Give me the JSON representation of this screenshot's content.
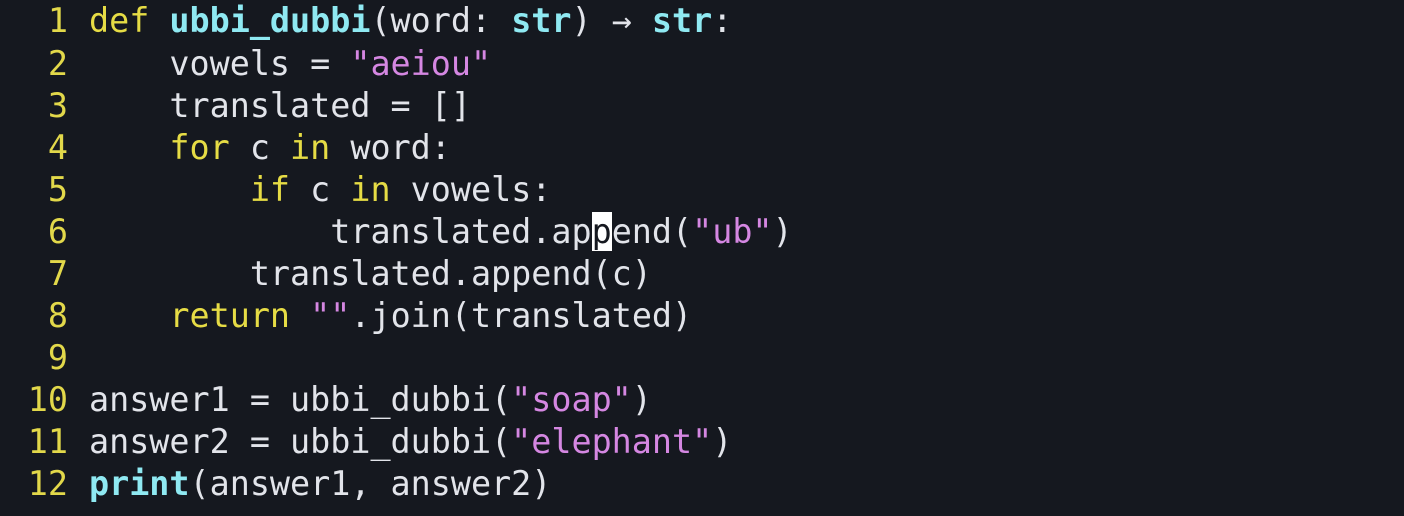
{
  "editor": {
    "language": "python",
    "cursor": {
      "line": 6,
      "column": 31
    },
    "colors": {
      "background": "#15181f",
      "line_number": "#e2d84a",
      "keyword": "#e6dc45",
      "function_and_type": "#8fe9f2",
      "string": "#d587e2",
      "default_text": "#e2e4ea",
      "cursor": "#ffffff"
    },
    "lines": [
      {
        "number": "1",
        "tokens": [
          {
            "text": "def",
            "kind": "kw"
          },
          {
            "text": " ",
            "kind": "tx"
          },
          {
            "text": "ubbi_dubbi",
            "kind": "fn"
          },
          {
            "text": "(word: ",
            "kind": "tx"
          },
          {
            "text": "str",
            "kind": "ty"
          },
          {
            "text": ") → ",
            "kind": "tx"
          },
          {
            "text": "str",
            "kind": "ty"
          },
          {
            "text": ":",
            "kind": "tx"
          }
        ]
      },
      {
        "number": "2",
        "tokens": [
          {
            "text": "    vowels = ",
            "kind": "tx"
          },
          {
            "text": "\"aeiou\"",
            "kind": "st"
          }
        ]
      },
      {
        "number": "3",
        "tokens": [
          {
            "text": "    translated = []",
            "kind": "tx"
          }
        ]
      },
      {
        "number": "4",
        "tokens": [
          {
            "text": "    ",
            "kind": "tx"
          },
          {
            "text": "for",
            "kind": "kw"
          },
          {
            "text": " c ",
            "kind": "tx"
          },
          {
            "text": "in",
            "kind": "kw"
          },
          {
            "text": " word:",
            "kind": "tx"
          }
        ]
      },
      {
        "number": "5",
        "tokens": [
          {
            "text": "        ",
            "kind": "tx"
          },
          {
            "text": "if",
            "kind": "kw"
          },
          {
            "text": " c ",
            "kind": "tx"
          },
          {
            "text": "in",
            "kind": "kw"
          },
          {
            "text": " vowels:",
            "kind": "tx"
          }
        ]
      },
      {
        "number": "6",
        "tokens": [
          {
            "text": "            translated.ap",
            "kind": "tx"
          },
          {
            "text": "p",
            "kind": "cursor"
          },
          {
            "text": "end(",
            "kind": "tx"
          },
          {
            "text": "\"ub\"",
            "kind": "st"
          },
          {
            "text": ")",
            "kind": "tx"
          }
        ]
      },
      {
        "number": "7",
        "tokens": [
          {
            "text": "        translated.append(c)",
            "kind": "tx"
          }
        ]
      },
      {
        "number": "8",
        "tokens": [
          {
            "text": "    ",
            "kind": "tx"
          },
          {
            "text": "return",
            "kind": "kw"
          },
          {
            "text": " ",
            "kind": "tx"
          },
          {
            "text": "\"\"",
            "kind": "st"
          },
          {
            "text": ".join(translated)",
            "kind": "tx"
          }
        ]
      },
      {
        "number": "9",
        "tokens": []
      },
      {
        "number": "10",
        "tokens": [
          {
            "text": "answer1 = ubbi_dubbi(",
            "kind": "tx"
          },
          {
            "text": "\"soap\"",
            "kind": "st"
          },
          {
            "text": ")",
            "kind": "tx"
          }
        ]
      },
      {
        "number": "11",
        "tokens": [
          {
            "text": "answer2 = ubbi_dubbi(",
            "kind": "tx"
          },
          {
            "text": "\"elephant\"",
            "kind": "st"
          },
          {
            "text": ")",
            "kind": "tx"
          }
        ]
      },
      {
        "number": "12",
        "tokens": [
          {
            "text": "print",
            "kind": "bi"
          },
          {
            "text": "(answer1, answer2)",
            "kind": "tx"
          }
        ]
      }
    ]
  }
}
